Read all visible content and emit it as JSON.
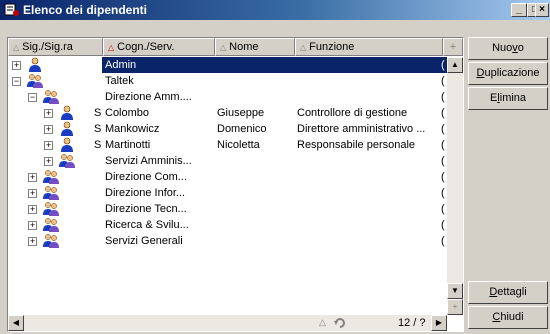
{
  "window": {
    "title": "Elenco dei dipendenti",
    "minimize": "_",
    "maximize": "□",
    "close": "×"
  },
  "columns": [
    "Sig./Sig.ra",
    "Cogn./Serv.",
    "Nome",
    "Funzione"
  ],
  "rows": [
    {
      "level": 0,
      "expander": "+",
      "icon": "person-icon",
      "prefix": "",
      "name": "Admin",
      "first": "",
      "role": "",
      "tail": "(",
      "selected": true
    },
    {
      "level": 0,
      "expander": "−",
      "icon": "group-icon",
      "prefix": "",
      "name": "Taltek",
      "first": "",
      "role": "",
      "tail": "("
    },
    {
      "level": 1,
      "expander": "−",
      "icon": "group-icon",
      "prefix": "",
      "name": "Direzione Amm....",
      "first": "",
      "role": "",
      "tail": "("
    },
    {
      "level": 2,
      "expander": "+",
      "icon": "person-icon",
      "prefix": "S",
      "name": "Colombo",
      "first": "Giuseppe",
      "role": "Controllore di gestione",
      "tail": "("
    },
    {
      "level": 2,
      "expander": "+",
      "icon": "person-icon",
      "prefix": "S",
      "name": "Mankowicz",
      "first": "Domenico",
      "role": "Direttore amministrativo ...",
      "tail": "("
    },
    {
      "level": 2,
      "expander": "+",
      "icon": "person-icon",
      "prefix": "S",
      "name": "Martinotti",
      "first": "Nicoletta",
      "role": "Responsabile personale",
      "tail": "("
    },
    {
      "level": 2,
      "expander": "+",
      "icon": "group-icon",
      "prefix": "",
      "name": "Servizi Amminis...",
      "first": "",
      "role": "",
      "tail": "("
    },
    {
      "level": 1,
      "expander": "+",
      "icon": "group-icon",
      "prefix": "",
      "name": "Direzione Com...",
      "first": "",
      "role": "",
      "tail": "("
    },
    {
      "level": 1,
      "expander": "+",
      "icon": "group-icon",
      "prefix": "",
      "name": "Direzione Infor...",
      "first": "",
      "role": "",
      "tail": "("
    },
    {
      "level": 1,
      "expander": "+",
      "icon": "group-icon",
      "prefix": "",
      "name": "Direzione Tecn...",
      "first": "",
      "role": "",
      "tail": "("
    },
    {
      "level": 1,
      "expander": "+",
      "icon": "group-icon",
      "prefix": "",
      "name": "Ricerca & Svilu...",
      "first": "",
      "role": "",
      "tail": "("
    },
    {
      "level": 1,
      "expander": "+",
      "icon": "group-icon",
      "prefix": "",
      "name": "Servizi Generali",
      "first": "",
      "role": "",
      "tail": "("
    }
  ],
  "status": {
    "count": "12 / ?"
  },
  "buttons": {
    "new": {
      "pre": "Nuo",
      "key": "v",
      "post": "o"
    },
    "duplicate": {
      "pre": "",
      "key": "D",
      "post": "uplicazione"
    },
    "delete": {
      "pre": "E",
      "key": "l",
      "post": "imina"
    },
    "details": {
      "pre": "",
      "key": "D",
      "post": "ettagli"
    },
    "close": {
      "pre": "",
      "key": "C",
      "post": "hiudi"
    }
  },
  "colors": {
    "titlebar_start": "#0a246a",
    "selection": "#0a246a",
    "face": "#d4d0c8"
  }
}
